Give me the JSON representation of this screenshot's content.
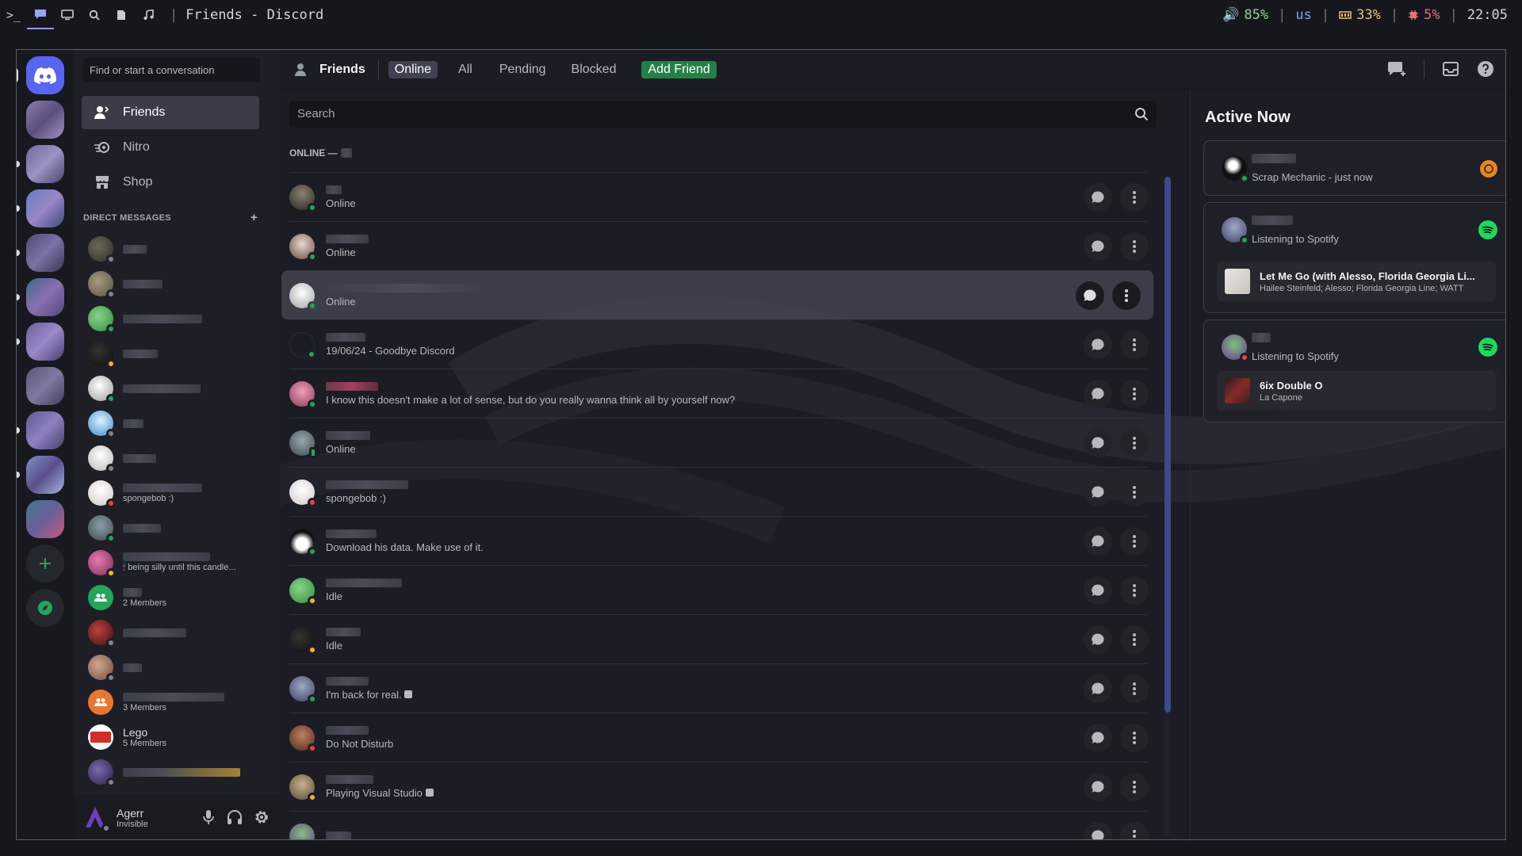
{
  "topbar": {
    "window_title": "Friends - Discord",
    "separator": "|",
    "volume": "85%",
    "layout": "us",
    "memory": "33%",
    "cpu": "5%",
    "clock": "22:05"
  },
  "dm_column": {
    "search_placeholder": "Find or start a conversation",
    "nav": [
      {
        "label": "Friends",
        "icon": "friends-icon"
      },
      {
        "label": "Nitro",
        "icon": "nitro-icon"
      },
      {
        "label": "Shop",
        "icon": "shop-icon"
      }
    ],
    "direct_messages_header": "DIRECT MESSAGES",
    "dms": [
      {
        "sub": "",
        "status": "off"
      },
      {
        "sub": "",
        "status": "off"
      },
      {
        "sub": "",
        "status": "on"
      },
      {
        "sub": "",
        "status": "idle"
      },
      {
        "sub": "",
        "status": "on"
      },
      {
        "sub": "",
        "status": "off"
      },
      {
        "sub": "",
        "status": "off"
      },
      {
        "sub": "spongebob :)",
        "status": "dnd"
      },
      {
        "sub": "",
        "status": "on"
      },
      {
        "sub": "being silly until this candle...",
        "status": "idle"
      },
      {
        "sub": "2 Members",
        "status": "group"
      },
      {
        "sub": "",
        "status": "off"
      },
      {
        "sub": "",
        "status": "off"
      },
      {
        "sub": "3 Members",
        "status": "group"
      },
      {
        "name": "Lego",
        "sub": "5 Members",
        "status": "group"
      },
      {
        "sub": "",
        "status": "off"
      }
    ]
  },
  "user": {
    "name": "Agerr",
    "status": "Invisible"
  },
  "header": {
    "title": "Friends",
    "tabs": [
      "Online",
      "All",
      "Pending",
      "Blocked"
    ],
    "add_friend": "Add Friend"
  },
  "friends": {
    "search_placeholder": "Search",
    "online_label": "ONLINE —",
    "rows": [
      {
        "status_text": "Online",
        "status": "on"
      },
      {
        "status_text": "Online",
        "status": "on"
      },
      {
        "status_text": "Online",
        "status": "on"
      },
      {
        "status_text": "19/06/24 - Goodbye Discord",
        "status": "on"
      },
      {
        "status_text": "I know this doesn't make a lot of sense, but do you really wanna think all by yourself now?",
        "status": "on"
      },
      {
        "status_text": "Online",
        "status": "on"
      },
      {
        "status_text": "spongebob :)",
        "status": "dnd"
      },
      {
        "status_text": "Download his data. Make use of it.",
        "status": "on"
      },
      {
        "status_text": "Idle",
        "status": "idle"
      },
      {
        "status_text": "Idle",
        "status": "idle"
      },
      {
        "status_text": "I'm back for real.",
        "status": "on"
      },
      {
        "status_text": "Do Not Disturb",
        "status": "dnd"
      },
      {
        "status_text": "Playing Visual Studio",
        "status": "idle"
      },
      {
        "status_text": "",
        "status": "on"
      }
    ]
  },
  "active_now": {
    "title": "Active Now",
    "cards": [
      {
        "activity": "Scrap Mechanic - just now"
      },
      {
        "activity": "Listening to Spotify",
        "track": "Let Me Go (with Alesso, Florida Georgia Li...",
        "artists": "Hailee Steinfeld; Alesso; Florida Georgia Line; WATT"
      },
      {
        "activity": "Listening to Spotify",
        "track": "6ix Double O",
        "artists": "La Capone"
      }
    ]
  },
  "colors": {
    "online": "#23a55a",
    "idle": "#f0b232",
    "dnd": "#f23f43",
    "offline": "#80848e",
    "add_friend": "#248046",
    "spotify": "#1ed760"
  }
}
